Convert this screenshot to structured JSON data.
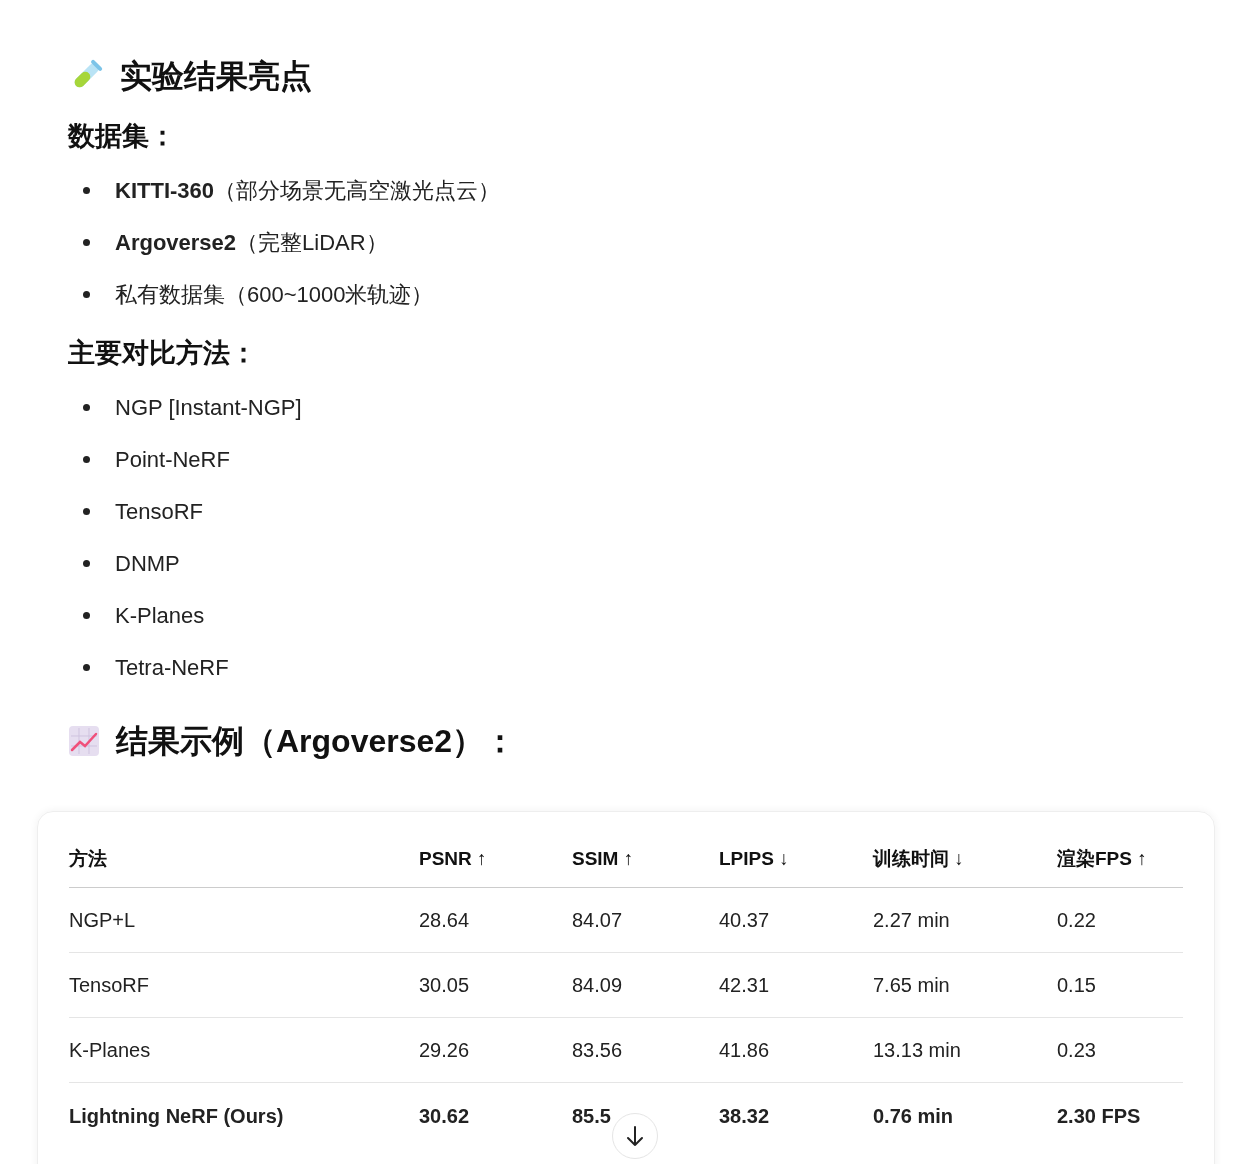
{
  "sections": [
    {
      "kind": "h2",
      "title": "实验结果亮点"
    },
    {
      "kind": "h3",
      "title": "数据集："
    },
    {
      "kind": "list",
      "items": [
        "**KITTI-360**（部分场景无高空激光点云）",
        "**Argoverse2**（完整LiDAR）",
        "私有数据集（600~1000米轨迹）"
      ]
    },
    {
      "kind": "h3",
      "title": "主要对比方法："
    },
    {
      "kind": "list",
      "items": [
        "NGP [Instant-NGP]",
        "Point-NeRF",
        "TensoRF",
        "DNMP",
        "K-Planes",
        "Tetra-NeRF"
      ]
    },
    {
      "kind": "h2",
      "title": "结果示例（Argoverse2）："
    }
  ],
  "table": {
    "columns": [
      "方法",
      "PSNR ↑",
      "SSIM ↑",
      "LPIPS ↓",
      "训练时间 ↓",
      "渲染FPS ↑"
    ],
    "rows": [
      {
        "bold": false,
        "cells": [
          "NGP+L",
          "28.64",
          "84.07",
          "40.37",
          "2.27 min",
          "0.22"
        ]
      },
      {
        "bold": false,
        "cells": [
          "TensoRF",
          "30.05",
          "84.09",
          "42.31",
          "7.65 min",
          "0.15"
        ]
      },
      {
        "bold": false,
        "cells": [
          "K-Planes",
          "29.26",
          "83.56",
          "41.86",
          "13.13 min",
          "0.23"
        ]
      },
      {
        "bold": true,
        "cells": [
          "Lightning NeRF (Ours)",
          "30.62",
          "85.5",
          "38.32",
          "0.76 min",
          "2.30 FPS"
        ]
      }
    ]
  }
}
